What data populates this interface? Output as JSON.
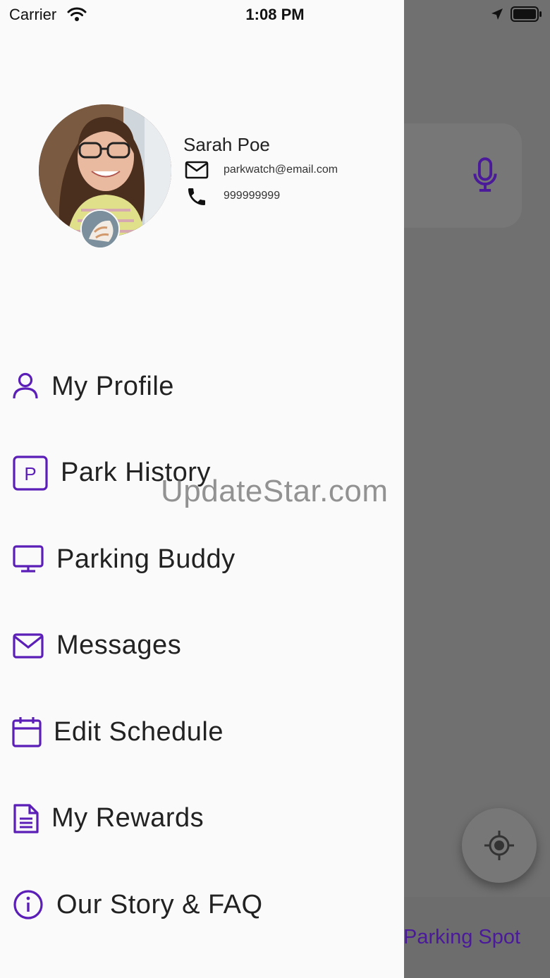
{
  "status_bar": {
    "carrier": "Carrier",
    "time": "1:08 PM"
  },
  "profile": {
    "name": "Sarah Poe",
    "email": "parkwatch@email.com",
    "phone": "999999999"
  },
  "menu": {
    "items": [
      {
        "label": "My Profile",
        "icon": "person-icon"
      },
      {
        "label": "Park History",
        "icon": "parking-icon",
        "icon_text": "P"
      },
      {
        "label": "Parking Buddy",
        "icon": "monitor-icon"
      },
      {
        "label": "Messages",
        "icon": "mail-icon"
      },
      {
        "label": "Edit Schedule",
        "icon": "calendar-icon"
      },
      {
        "label": "My Rewards",
        "icon": "document-icon"
      },
      {
        "label": "Our Story & FAQ",
        "icon": "info-icon"
      }
    ]
  },
  "background": {
    "bottom_label": "Parking Spot"
  },
  "watermark": "UpdateStar.com",
  "colors": {
    "accent": "#5b1fb8",
    "drawer_bg": "#fafafa",
    "scrim": "#707070"
  }
}
